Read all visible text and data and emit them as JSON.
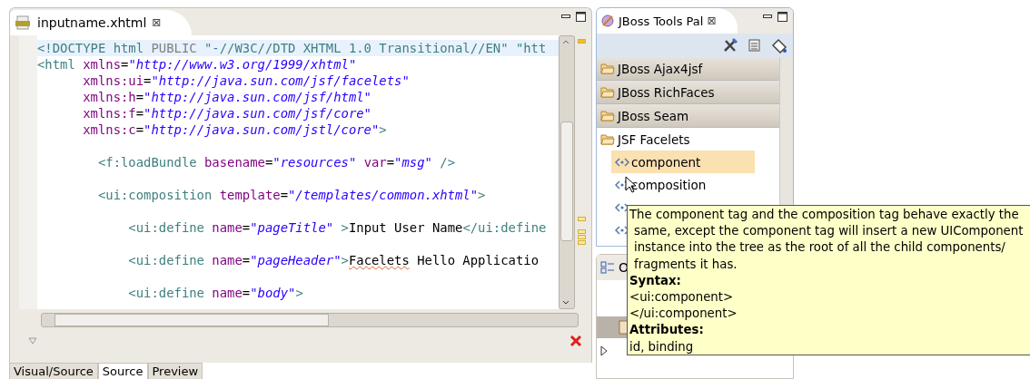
{
  "editor": {
    "tab": {
      "title": "inputname.xhtml",
      "close": "⊠"
    },
    "lines": [
      {
        "kind": "code",
        "current": true,
        "tokens": [
          {
            "kind": "tag",
            "text": "<!DOCTYPE html "
          },
          {
            "kind": "keyword",
            "text": "PUBLIC"
          },
          {
            "kind": "tag",
            "text": " \"-//W3C//DTD XHTML 1.0 Transitional//EN\" \"htt"
          }
        ]
      },
      {
        "kind": "code",
        "current": false,
        "tokens": [
          {
            "kind": "tag",
            "text": "<html "
          },
          {
            "kind": "attr",
            "text": "xmlns"
          },
          {
            "kind": "plain",
            "text": "="
          },
          {
            "kind": "value",
            "text": "\"http://www.w3.org/1999/xhtml\""
          }
        ]
      },
      {
        "kind": "code",
        "current": false,
        "tokens": [
          {
            "kind": "attr",
            "text": "      xmlns:ui"
          },
          {
            "kind": "plain",
            "text": "="
          },
          {
            "kind": "value",
            "text": "\"http://java.sun.com/jsf/facelets\""
          }
        ]
      },
      {
        "kind": "code",
        "current": false,
        "tokens": [
          {
            "kind": "attr",
            "text": "      xmlns:h"
          },
          {
            "kind": "plain",
            "text": "="
          },
          {
            "kind": "value",
            "text": "\"http://java.sun.com/jsf/html\""
          }
        ]
      },
      {
        "kind": "code",
        "current": false,
        "tokens": [
          {
            "kind": "attr",
            "text": "      xmlns:f"
          },
          {
            "kind": "plain",
            "text": "="
          },
          {
            "kind": "value",
            "text": "\"http://java.sun.com/jsf/core\""
          }
        ]
      },
      {
        "kind": "code",
        "current": false,
        "tokens": [
          {
            "kind": "attr",
            "text": "      xmlns:c"
          },
          {
            "kind": "plain",
            "text": "="
          },
          {
            "kind": "value",
            "text": "\"http://java.sun.com/jstl/core\""
          },
          {
            "kind": "tag",
            "text": ">"
          }
        ]
      },
      {
        "kind": "blank"
      },
      {
        "kind": "code",
        "current": false,
        "tokens": [
          {
            "kind": "tag",
            "text": "        <f:loadBundle "
          },
          {
            "kind": "attr",
            "text": "basename"
          },
          {
            "kind": "plain",
            "text": "="
          },
          {
            "kind": "value",
            "text": "\"resources\""
          },
          {
            "kind": "attr",
            "text": " var"
          },
          {
            "kind": "plain",
            "text": "="
          },
          {
            "kind": "value",
            "text": "\"msg\""
          },
          {
            "kind": "tag",
            "text": " />"
          }
        ]
      },
      {
        "kind": "blank"
      },
      {
        "kind": "code",
        "current": false,
        "tokens": [
          {
            "kind": "tag",
            "text": "        <ui:composition "
          },
          {
            "kind": "attr",
            "text": "template"
          },
          {
            "kind": "plain",
            "text": "="
          },
          {
            "kind": "value",
            "text": "\"/templates/common.xhtml\""
          },
          {
            "kind": "tag",
            "text": ">"
          }
        ]
      },
      {
        "kind": "blank"
      },
      {
        "kind": "code",
        "current": false,
        "tokens": [
          {
            "kind": "tag",
            "text": "            <ui:define "
          },
          {
            "kind": "attr",
            "text": "name"
          },
          {
            "kind": "plain",
            "text": "="
          },
          {
            "kind": "value",
            "text": "\"pageTitle\""
          },
          {
            "kind": "tag",
            "text": " >"
          },
          {
            "kind": "plain",
            "text": "Input User Name"
          },
          {
            "kind": "tag",
            "text": "</ui:define"
          }
        ]
      },
      {
        "kind": "blank"
      },
      {
        "kind": "code",
        "current": false,
        "tokens": [
          {
            "kind": "tag",
            "text": "            <ui:define "
          },
          {
            "kind": "attr",
            "text": "name"
          },
          {
            "kind": "plain",
            "text": "="
          },
          {
            "kind": "value",
            "text": "\"pageHeader\""
          },
          {
            "kind": "tag",
            "text": ">"
          },
          {
            "kind": "misspelled",
            "text": "Facelets"
          },
          {
            "kind": "plain",
            "text": " Hello Applicatio"
          }
        ]
      },
      {
        "kind": "blank"
      },
      {
        "kind": "code",
        "current": false,
        "tokens": [
          {
            "kind": "tag",
            "text": "            <ui:define "
          },
          {
            "kind": "attr",
            "text": "name"
          },
          {
            "kind": "plain",
            "text": "="
          },
          {
            "kind": "value",
            "text": "\"body\""
          },
          {
            "kind": "tag",
            "text": ">"
          }
        ]
      }
    ],
    "bottom_tabs": [
      {
        "label": "Visual/Source",
        "selected": false
      },
      {
        "label": "Source",
        "selected": true
      },
      {
        "label": "Preview",
        "selected": false
      }
    ]
  },
  "palette": {
    "tab": {
      "title": "JBoss Tools Pal",
      "close": "⊠"
    },
    "groups": [
      {
        "label": "JBoss Ajax4jsf",
        "expanded": false
      },
      {
        "label": "JBoss RichFaces",
        "expanded": false
      },
      {
        "label": "JBoss Seam",
        "expanded": false
      },
      {
        "label": "JSF Facelets",
        "expanded": true,
        "items": [
          {
            "label": "component",
            "selected": true
          },
          {
            "label": "composition",
            "selected": false
          },
          {
            "selected": false
          },
          {
            "selected": false
          }
        ]
      }
    ]
  },
  "outline": {
    "title": "O"
  },
  "tooltip": {
    "lines": [
      "The component tag and the composition tag behave exactly the",
      "same, except the component tag will insert a new UIComponent",
      "instance into the tree as the root of all the child components/",
      "fragments it has."
    ],
    "sections": [
      {
        "heading": "Syntax:",
        "lines": [
          "<ui:component>",
          "</ui:component>"
        ]
      },
      {
        "heading": "Attributes:",
        "lines": [
          "id, binding"
        ]
      }
    ]
  }
}
